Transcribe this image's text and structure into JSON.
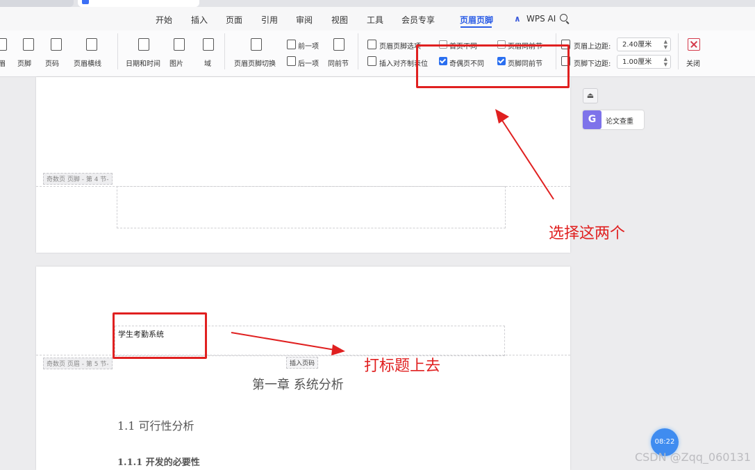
{
  "tabs": {
    "doc_tab_title": ""
  },
  "menu": {
    "items": [
      "开始",
      "插入",
      "页面",
      "引用",
      "审阅",
      "视图",
      "工具",
      "会员专享",
      "页眉页脚",
      "WPS AI"
    ],
    "active": "页眉页脚"
  },
  "ribbon": {
    "group1": [
      "眉",
      "页脚",
      "页码",
      "页眉横线"
    ],
    "group2": [
      "日期和时间",
      "图片",
      "域"
    ],
    "group3": {
      "switch": "页眉页脚切换",
      "prev": "前一项",
      "next": "后一项",
      "same_as_prev": "同前节"
    },
    "group4": {
      "options": "页眉页脚选项",
      "first_page_diff": "首页不同",
      "same_as_prev_header": "页眉同前节",
      "insert_align_tab": "插入对齐制表位",
      "odd_even_diff": "奇偶页不同",
      "footer_same_as_prev": "页脚同前节"
    },
    "group5": {
      "header_top_label": "页眉上边距:",
      "header_top_value": "2.40厘米",
      "footer_bottom_label": "页脚下边距:",
      "footer_bottom_value": "1.00厘米"
    },
    "close": "关闭"
  },
  "checkboxes": {
    "first_page_diff": false,
    "same_as_prev_header": false,
    "odd_even_diff": true,
    "footer_same_as_prev": true
  },
  "page1": {
    "footer_tag": "奇数页 页脚 - 第 4 节-"
  },
  "page2": {
    "header_text": "学生考勤系统",
    "header_tag": "奇数页 页眉 - 第 5 节-",
    "insert_page_number": "插入页码",
    "chapter": "第一章 系统分析",
    "section": "1.1 可行性分析",
    "subsection": "1.1.1 开发的必要性"
  },
  "side_panel": {
    "paper_check": "论文查重"
  },
  "annotations": {
    "select_two": "选择这两个",
    "title_here": "打标题上去"
  },
  "timer": "08:22",
  "watermark": "CSDN @Zqq_060131",
  "colors": {
    "accent": "#2a5ce6",
    "annotation": "#e02020"
  }
}
